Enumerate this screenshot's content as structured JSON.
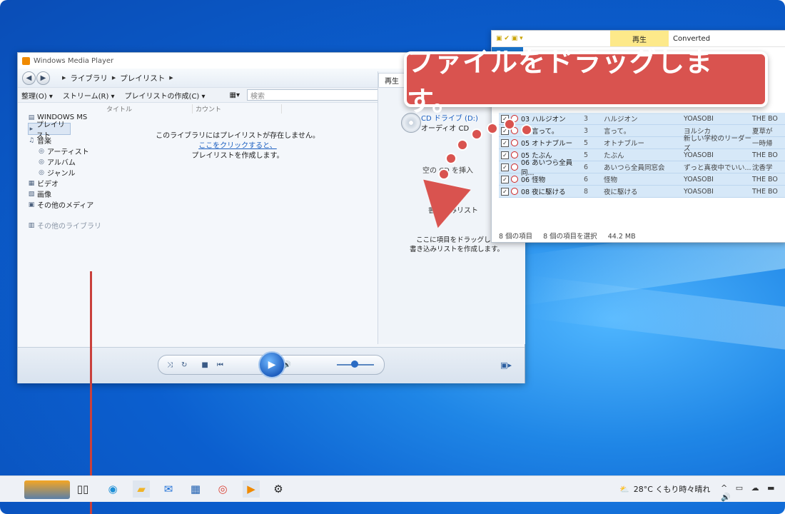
{
  "wmp": {
    "title": "Windows Media Player",
    "breadcrumb": [
      "ライブラリ",
      "プレイリスト"
    ],
    "toolbar": {
      "organize": "整理(O)",
      "stream": "ストリーム(R)",
      "create_playlist": "プレイリストの作成(C)",
      "search_placeholder": "検索"
    },
    "nav": {
      "library_owner": "WINDOWS MS",
      "playlist": "プレイリスト",
      "music": "音楽",
      "artist": "アーティスト",
      "album": "アルバム",
      "genre": "ジャンル",
      "video": "ビデオ",
      "picture": "画像",
      "other_media": "その他のメディア",
      "other_libraries": "その他のライブラリ"
    },
    "columns": {
      "title": "タイトル",
      "count": "カウント"
    },
    "empty": {
      "line1": "このライブラリにはプレイリストが存在しません。",
      "link": "ここをクリックすると、",
      "line3": "プレイリストを作成します。"
    },
    "right": {
      "tab": "再生",
      "cd_drive": "CD ドライブ (D:)",
      "cd_type": "オーディオ CD",
      "blank_cd": "空の CD を挿入",
      "burn_list": "書き込みリスト",
      "drag_line1": "ここに項目をドラッグして",
      "drag_line2": "書き込みリストを作成します。"
    }
  },
  "explorer": {
    "context_tab": "再生",
    "folder_name": "Converted",
    "rows": [
      {
        "name": "03 ハルジオン",
        "no": "3",
        "title": "ハルジオン",
        "artist": "YOASOBI",
        "album": "THE BO"
      },
      {
        "name": "04 言って。",
        "no": "3",
        "title": "言って。",
        "artist": "ヨルシカ",
        "album": "夏草が"
      },
      {
        "name": "05 オトナブルー",
        "no": "5",
        "title": "オトナブルー",
        "artist": "新しい学校のリーダーズ",
        "album": "一時帰"
      },
      {
        "name": "05 たぶん",
        "no": "5",
        "title": "たぶん",
        "artist": "YOASOBI",
        "album": "THE BO"
      },
      {
        "name": "06 あいつら全員同...",
        "no": "6",
        "title": "あいつら全員同窓会",
        "artist": "ずっと真夜中でいい...",
        "album": "沈香学"
      },
      {
        "name": "06 怪物",
        "no": "6",
        "title": "怪物",
        "artist": "YOASOBI",
        "album": "THE BO"
      },
      {
        "name": "08 夜に駆ける",
        "no": "8",
        "title": "夜に駆ける",
        "artist": "YOASOBI",
        "album": "THE BO"
      }
    ],
    "status_items": "8 個の項目",
    "status_selected": "8 個の項目を選択",
    "status_size": "44.2 MB"
  },
  "callout": {
    "text": "ファイルをドラッグします。"
  },
  "taskbar": {
    "weather": "28°C くもり時々晴れ"
  }
}
